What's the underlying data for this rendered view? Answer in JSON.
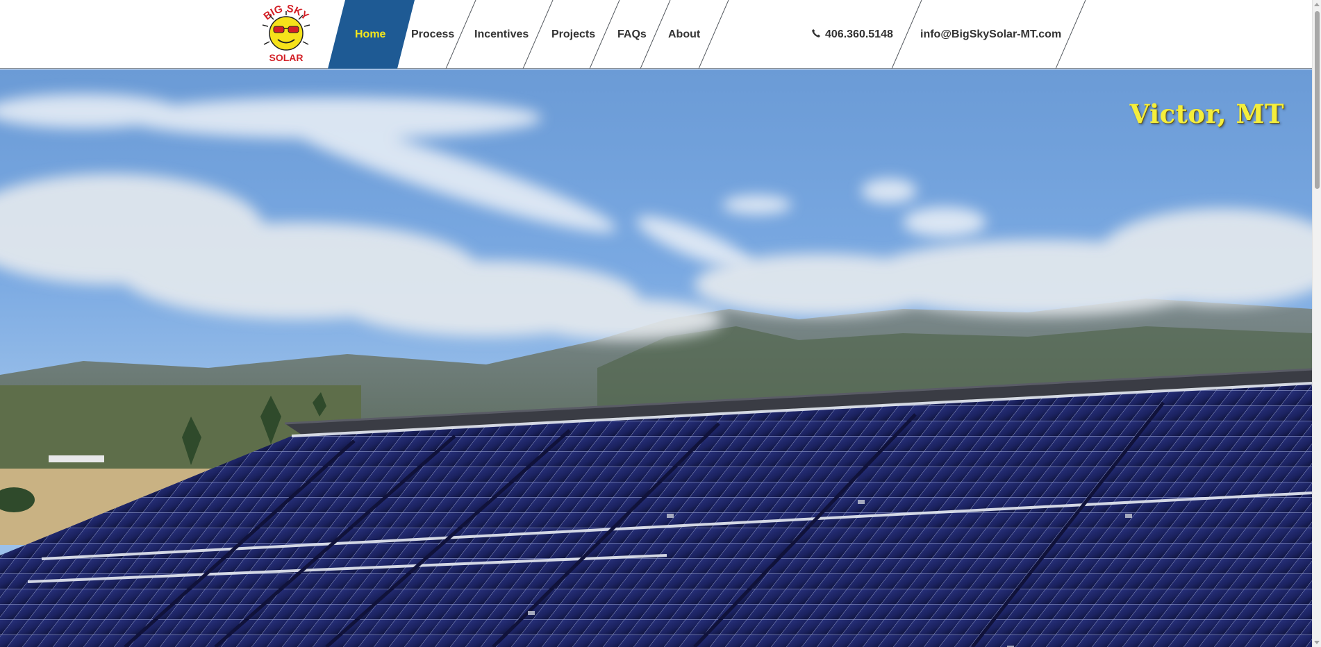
{
  "logo": {
    "top_text": "BIG SKY",
    "bottom_text": "SOLAR"
  },
  "nav": {
    "items": [
      {
        "label": "Home",
        "active": true
      },
      {
        "label": "Process"
      },
      {
        "label": "Incentives"
      },
      {
        "label": "Projects"
      },
      {
        "label": "FAQs"
      },
      {
        "label": "About"
      }
    ],
    "active_color": "#1e5a94",
    "active_text_color": "#f6e71a"
  },
  "contact": {
    "phone": "406.360.5148",
    "phone_icon": "phone-icon",
    "email": "info@BigSkySolar-MT.com"
  },
  "hero": {
    "location": "Victor, MT",
    "location_color": "#f4ee3c"
  }
}
